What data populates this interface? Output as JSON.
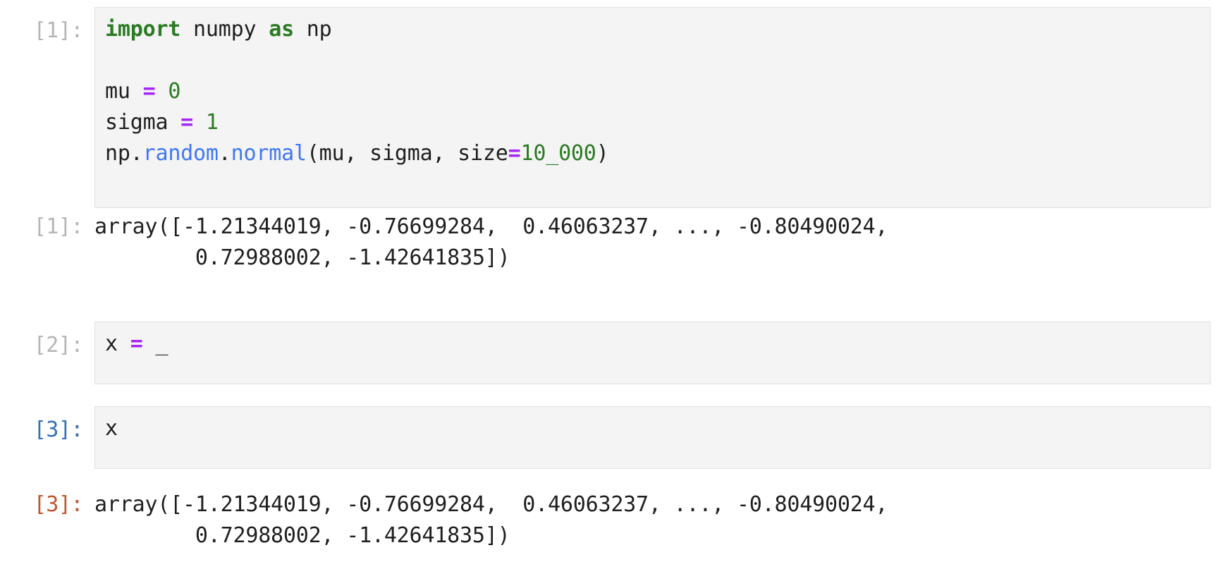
{
  "notebook": {
    "kind": "jupyter-notebook-cells",
    "colors": {
      "cell_background": "#f4f4f4",
      "cell_border": "#e0e0e0",
      "prompt_idle": "#b5b5b5",
      "prompt_selected": "#3572b0",
      "prompt_output": "#c0562e",
      "keyword": "#2c7a24",
      "operator": "#a626f7",
      "number": "#2c7a24",
      "attribute": "#4078f2",
      "plain_text": "#1f1f1f"
    },
    "cells": [
      {
        "id": "cell-1",
        "input_prompt": "[1]:",
        "input_prompt_color": "gray",
        "source_lines": [
          [
            {
              "t": "import",
              "c": "kw"
            },
            {
              "t": " numpy ",
              "c": "pl"
            },
            {
              "t": "as",
              "c": "kw"
            },
            {
              "t": " np",
              "c": "pl"
            }
          ],
          [
            {
              "t": "",
              "c": "pl"
            }
          ],
          [
            {
              "t": "mu ",
              "c": "pl"
            },
            {
              "t": "=",
              "c": "op"
            },
            {
              "t": " ",
              "c": "pl"
            },
            {
              "t": "0",
              "c": "num"
            }
          ],
          [
            {
              "t": "sigma ",
              "c": "pl"
            },
            {
              "t": "=",
              "c": "op"
            },
            {
              "t": " ",
              "c": "pl"
            },
            {
              "t": "1",
              "c": "num"
            }
          ],
          [
            {
              "t": "np.",
              "c": "pl"
            },
            {
              "t": "random",
              "c": "fn"
            },
            {
              "t": ".",
              "c": "pl"
            },
            {
              "t": "normal",
              "c": "fn"
            },
            {
              "t": "(mu, sigma, size",
              "c": "pl"
            },
            {
              "t": "=",
              "c": "op"
            },
            {
              "t": "10_000",
              "c": "num"
            },
            {
              "t": ")",
              "c": "pl"
            }
          ]
        ],
        "source_plain": "import numpy as np\n\nmu = 0\nsigma = 1\nnp.random.normal(mu, sigma, size=10_000)",
        "output_prompt": "[1]:",
        "output_prompt_color": "gray",
        "output_text": "array([-1.21344019, -0.76699284,  0.46063237, ..., -0.80490024,\n        0.72988002, -1.42641835])"
      },
      {
        "id": "cell-2",
        "input_prompt": "[2]:",
        "input_prompt_color": "gray",
        "source_lines": [
          [
            {
              "t": "x ",
              "c": "pl"
            },
            {
              "t": "=",
              "c": "op"
            },
            {
              "t": " _",
              "c": "pl"
            }
          ]
        ],
        "source_plain": "x = _",
        "output_prompt": null,
        "output_prompt_color": null,
        "output_text": null
      },
      {
        "id": "cell-3",
        "input_prompt": "[3]:",
        "input_prompt_color": "blue",
        "source_lines": [
          [
            {
              "t": "x",
              "c": "pl"
            }
          ]
        ],
        "source_plain": "x",
        "output_prompt": "[3]:",
        "output_prompt_color": "rust",
        "output_text": "array([-1.21344019, -0.76699284,  0.46063237, ..., -0.80490024,\n        0.72988002, -1.42641835])"
      }
    ]
  }
}
